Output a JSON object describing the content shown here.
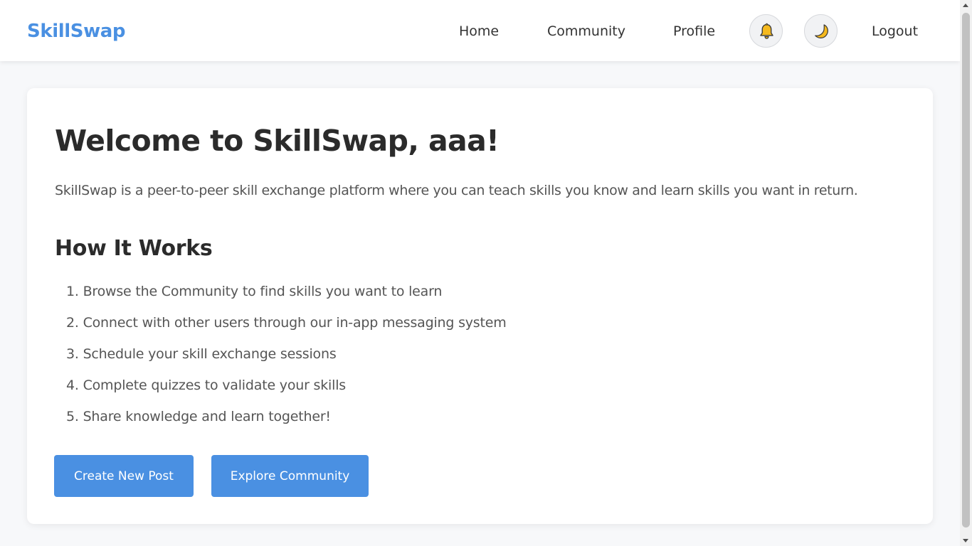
{
  "colors": {
    "brand": "#4a90e2",
    "button_bg": "#4a90e2",
    "button_text": "#ffffff"
  },
  "nav": {
    "logo": "SkillSwap",
    "links": [
      {
        "label": "Home"
      },
      {
        "label": "Community"
      },
      {
        "label": "Profile"
      }
    ],
    "notifications_icon": "bell-icon",
    "theme_icon": "moon-icon",
    "logout": "Logout"
  },
  "main": {
    "title": "Welcome to SkillSwap, aaa!",
    "intro": "SkillSwap is a peer-to-peer skill exchange platform where you can teach skills you know and learn skills you want in return.",
    "how_title": "How It Works",
    "steps": [
      "1. Browse the Community to find skills you want to learn",
      "2. Connect with other users through our in-app messaging system",
      "3. Schedule your skill exchange sessions",
      "4. Complete quizzes to validate your skills",
      "5. Share knowledge and learn together!"
    ],
    "buttons": {
      "create": "Create New Post",
      "explore": "Explore Community"
    }
  }
}
